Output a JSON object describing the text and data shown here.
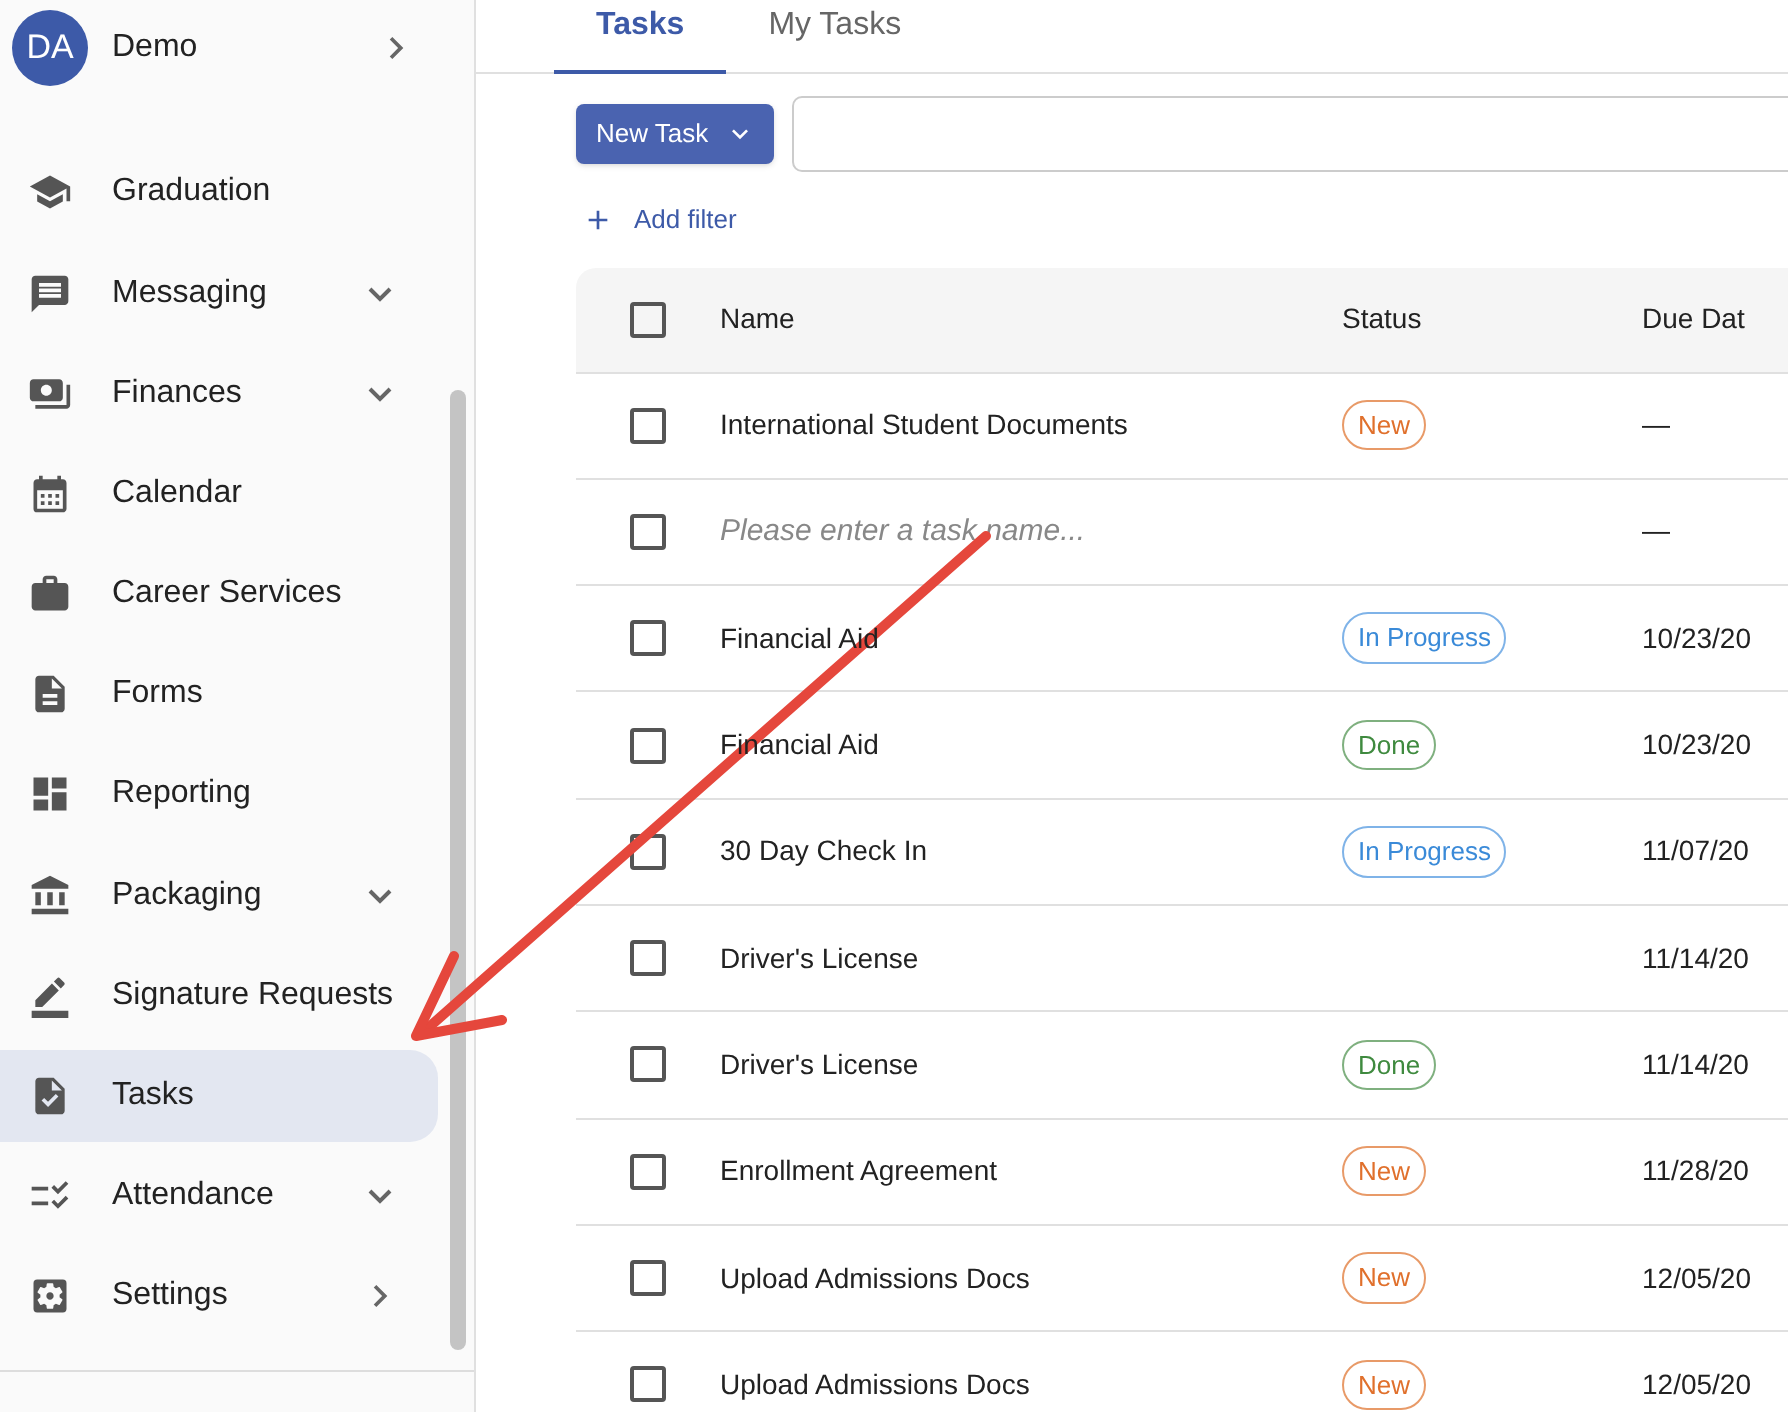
{
  "user": {
    "initials": "DA",
    "name": "Demo"
  },
  "sidebar": {
    "items": [
      {
        "label": "Graduation",
        "kind": "link",
        "selected": false
      },
      {
        "label": "Messaging",
        "kind": "group",
        "selected": false
      },
      {
        "label": "Finances",
        "kind": "group",
        "selected": false
      },
      {
        "label": "Calendar",
        "kind": "link",
        "selected": false
      },
      {
        "label": "Career Services",
        "kind": "link",
        "selected": false
      },
      {
        "label": "Forms",
        "kind": "link",
        "selected": false
      },
      {
        "label": "Reporting",
        "kind": "link",
        "selected": false
      },
      {
        "label": "Packaging",
        "kind": "group",
        "selected": false
      },
      {
        "label": "Signature Requests",
        "kind": "link",
        "selected": false
      },
      {
        "label": "Tasks",
        "kind": "link",
        "selected": true
      },
      {
        "label": "Attendance",
        "kind": "group",
        "selected": false
      },
      {
        "label": "Settings",
        "kind": "submenu",
        "selected": false
      }
    ]
  },
  "tabs": [
    {
      "label": "Tasks",
      "selected": true
    },
    {
      "label": "My Tasks",
      "selected": false
    }
  ],
  "toolbar": {
    "new_button": "New Task"
  },
  "add_filter": "Add filter",
  "table": {
    "select_all": {
      "checked": false
    },
    "columns": [
      "Name",
      "Status",
      "Due Dat"
    ],
    "rows": [
      {
        "kind": "task",
        "name": "International Student Documents",
        "status": {
          "label": "New",
          "kind": "new"
        },
        "due": "—",
        "checked": false
      },
      {
        "kind": "input",
        "placeholder": "Please enter a task name...",
        "due": "—",
        "checked": false
      },
      {
        "kind": "task",
        "name": "Financial Aid",
        "status": {
          "label": "In Progress",
          "kind": "progress"
        },
        "due": "10/23/20",
        "checked": false
      },
      {
        "kind": "task",
        "name": "Financial Aid",
        "status": {
          "label": "Done",
          "kind": "done"
        },
        "due": "10/23/20",
        "checked": false
      },
      {
        "kind": "task",
        "name": "30 Day Check In",
        "status": {
          "label": "In Progress",
          "kind": "progress"
        },
        "due": "11/07/20",
        "checked": false
      },
      {
        "kind": "task",
        "name": "Driver's License",
        "due": "11/14/20",
        "checked": false
      },
      {
        "kind": "task",
        "name": "Driver's License",
        "status": {
          "label": "Done",
          "kind": "done"
        },
        "due": "11/14/20",
        "checked": false
      },
      {
        "kind": "task",
        "name": "Enrollment Agreement",
        "status": {
          "label": "New",
          "kind": "new"
        },
        "due": "11/28/20",
        "checked": false
      },
      {
        "kind": "task",
        "name": "Upload Admissions Docs",
        "status": {
          "label": "New",
          "kind": "new"
        },
        "due": "12/05/20",
        "checked": false
      },
      {
        "kind": "task",
        "name": "Upload Admissions Docs",
        "status": {
          "label": "New",
          "kind": "new"
        },
        "due": "12/05/20",
        "checked": false
      }
    ]
  }
}
